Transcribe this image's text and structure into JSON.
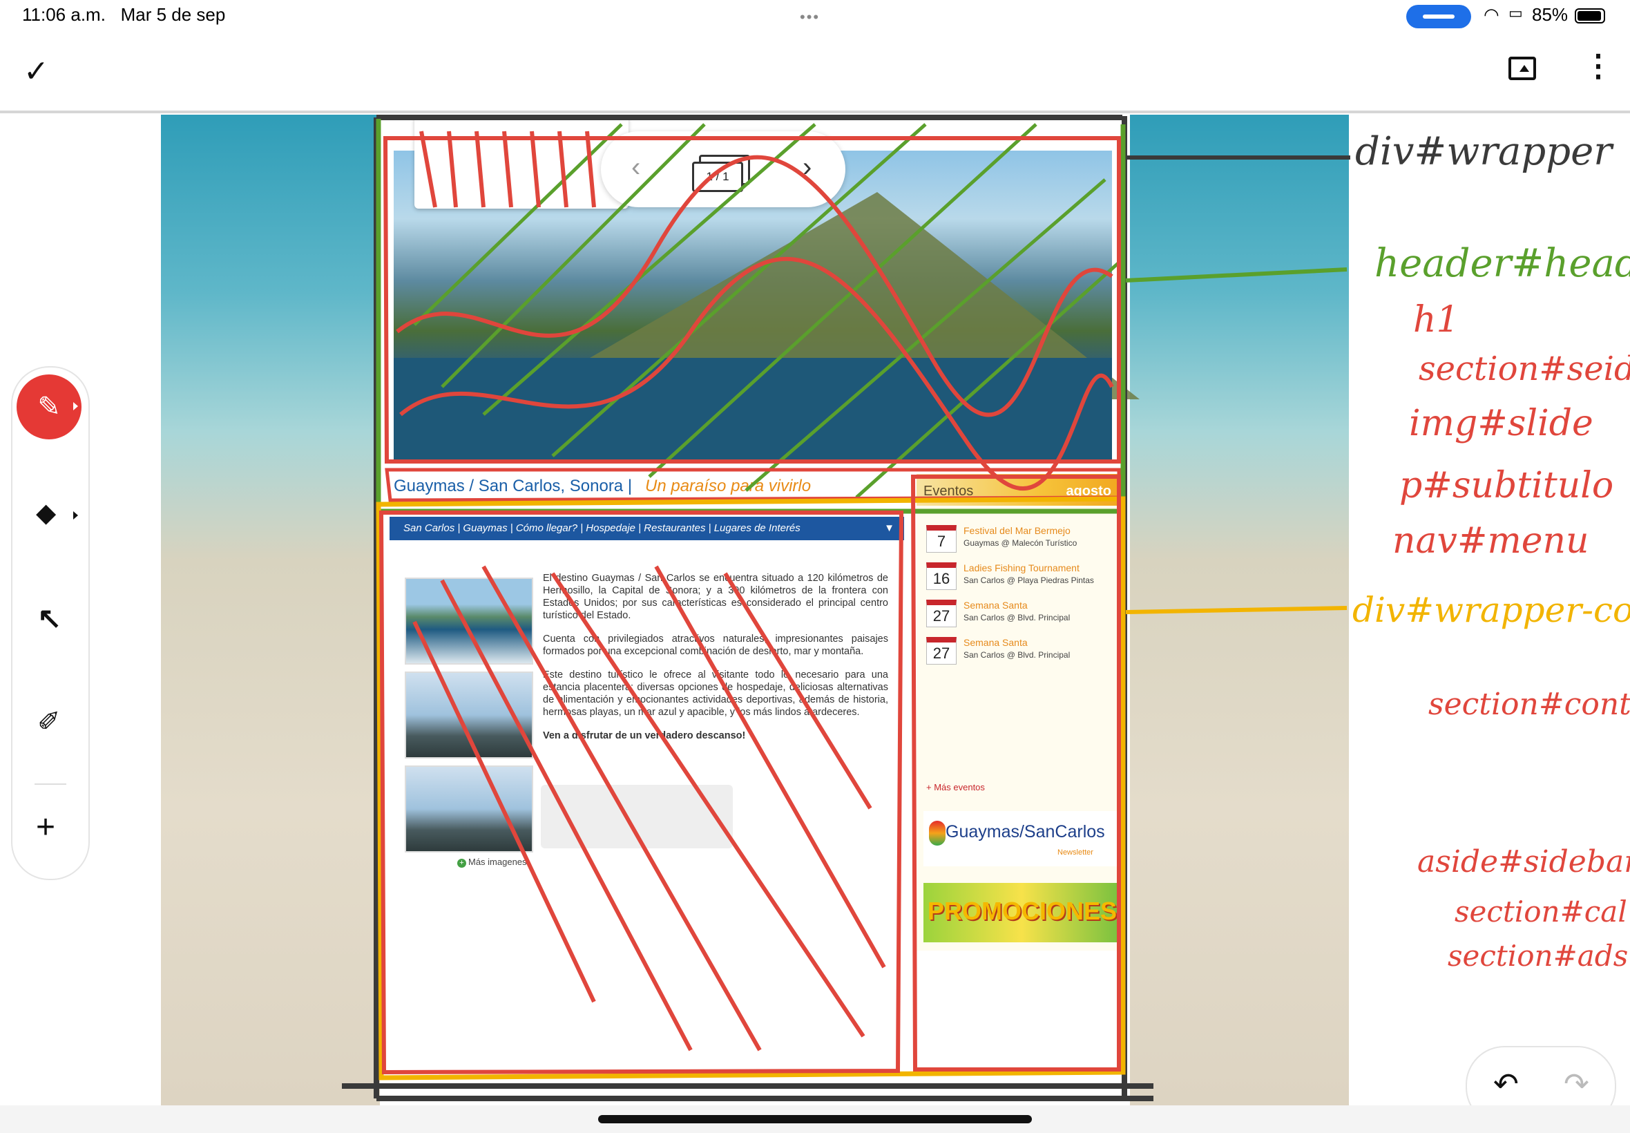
{
  "status_bar": {
    "time": "11:06 a.m.",
    "date": "Mar 5 de sep",
    "battery": "85%"
  },
  "toolbar": {
    "done_icon": "check-icon",
    "share_icon": "present-icon",
    "more_icon": "more-vertical-icon"
  },
  "pager": {
    "count": "1 / 1"
  },
  "website": {
    "title": "Guaymas / San Carlos, Sonora |",
    "subtitle": "Un paraíso para vivirlo",
    "nav": "San Carlos | Guaymas | Cómo llegar? | Hospedaje | Restaurantes | Lugares de Interés",
    "nav_arrow": "▼",
    "paragraphs": [
      "El destino Guaymas / San Carlos se encuentra situado a 120 kilómetros de Hermosillo, la Capital de Sonora; y a 390 kilómetros de la frontera con Estados Unidos; por sus características es considerado el principal centro turístico del Estado.",
      "Cuenta con privilegiados atractivos naturales, impresionantes paisajes formados por una excepcional combinación de desierto, mar y montaña.",
      "Este destino turístico le ofrece al visitante todo lo necesario para una estancia placentera: diversas opciones de hospedaje, deliciosas alternativas de alimentación y emocionantes actividades deportivas, además de historia, hermosas playas, un mar azul y apacible, y los más lindos atardeceres.",
      "Ven a disfrutar de un verdadero descanso!"
    ],
    "more_images": "Más imagenes",
    "events_label": "Eventos",
    "events_month": "agosto",
    "events": [
      {
        "day": "7",
        "name": "Festival del Mar Bermejo",
        "place": "Guaymas @ Malecón Turístico"
      },
      {
        "day": "16",
        "name": "Ladies Fishing Tournament",
        "place": "San Carlos @ Playa Piedras Pintas"
      },
      {
        "day": "27",
        "name": "Semana Santa",
        "place": "San Carlos @ Blvd. Principal"
      },
      {
        "day": "27",
        "name": "Semana Santa",
        "place": "San Carlos @ Blvd. Principal"
      }
    ],
    "more_events": "+ Más eventos",
    "newsletter_brand": "Guaymas/SanCarlos",
    "newsletter_sub": "Newsletter",
    "promo": "PROMOCIONES"
  },
  "annotations": [
    "div#wrapper",
    "header#header",
    "h1",
    "section#seid",
    "img#slide",
    "p#subtitulo",
    "nav#menu",
    "div#wrapper-content",
    "section#content",
    "aside#sidebar",
    "section#cal",
    "section#ads"
  ],
  "colors": {
    "annotation_black": "#3a3a3a",
    "annotation_green": "#5aa02c",
    "annotation_red": "#e0463c",
    "annotation_yellow": "#f2b400",
    "pen_active": "#e53935"
  },
  "tools": {
    "pen": "pen-icon",
    "eraser": "eraser-icon",
    "select": "select-arrow-icon",
    "lasso": "lasso-icon",
    "add": "plus-icon",
    "undo": "undo-icon",
    "redo": "redo-icon"
  }
}
